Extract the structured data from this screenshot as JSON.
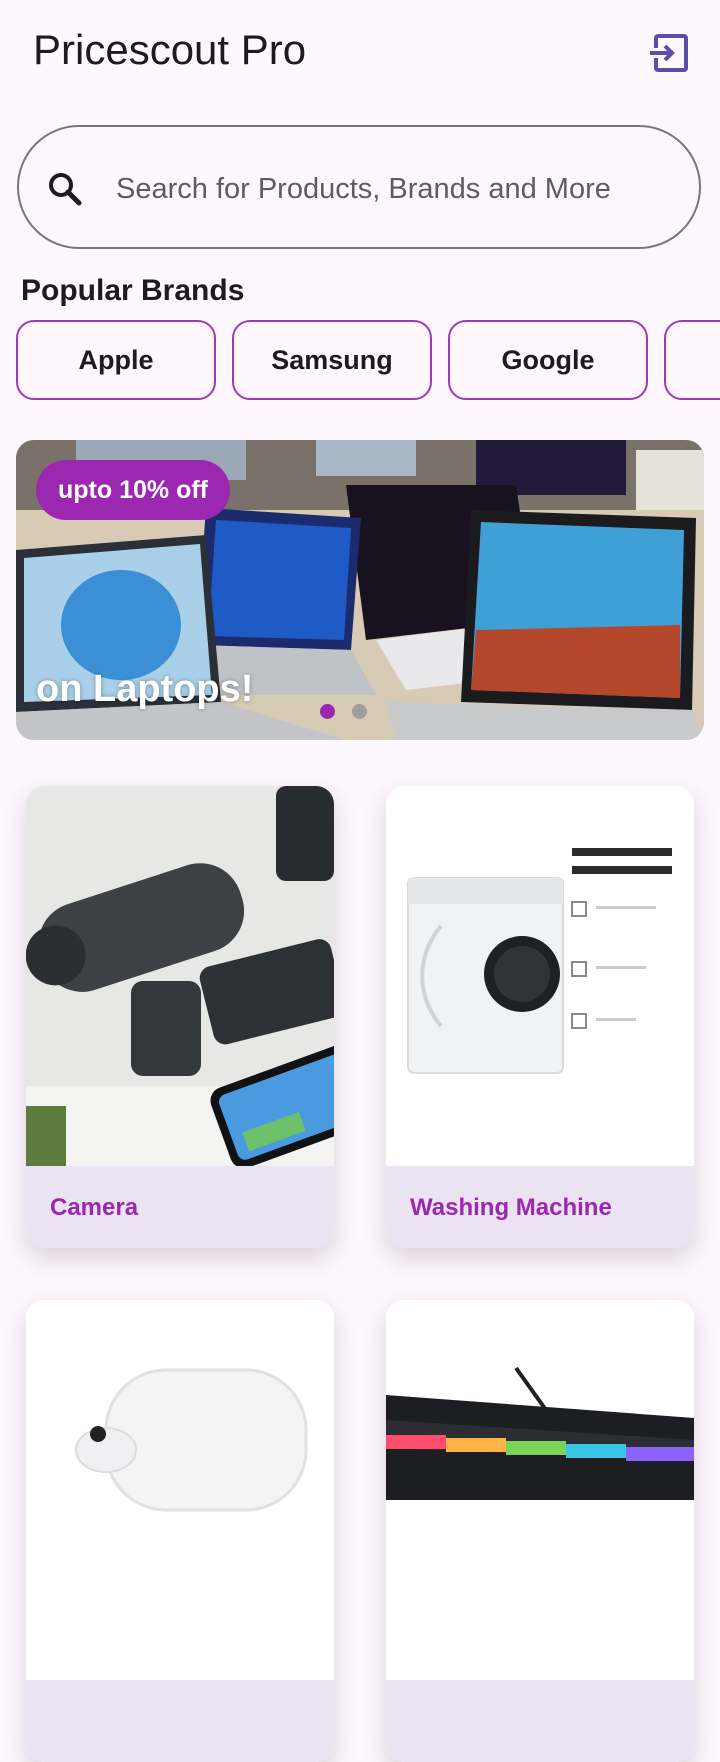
{
  "app": {
    "title": "Pricescout Pro",
    "logout_icon": "logout-icon"
  },
  "search": {
    "placeholder": "Search for Products, Brands and More",
    "value": ""
  },
  "brands": {
    "title": "Popular Brands",
    "items": [
      "Apple",
      "Samsung",
      "Google",
      "…"
    ]
  },
  "banner": {
    "badge": "upto 10% off",
    "caption": "on Laptops!",
    "active_slide": 1,
    "slide_count": 2
  },
  "categories": [
    {
      "label": "Camera"
    },
    {
      "label": "Washing Machine"
    },
    {
      "label": ""
    },
    {
      "label": ""
    }
  ],
  "colors": {
    "accent": "#9c27b0",
    "background": "#fef7fd",
    "card_label_bg": "#ebe3f2"
  }
}
